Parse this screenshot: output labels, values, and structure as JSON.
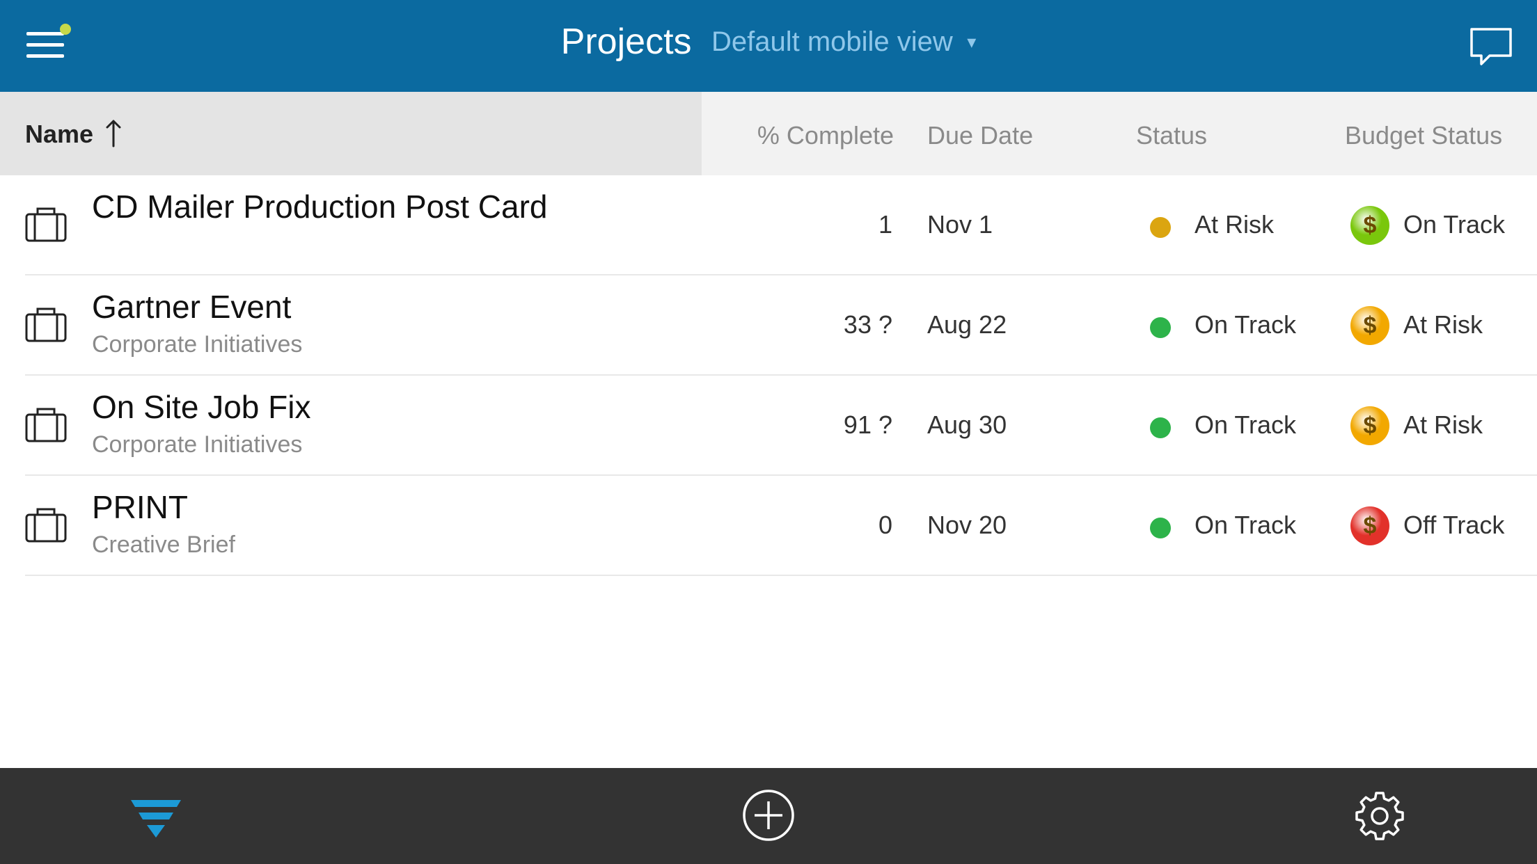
{
  "header": {
    "title": "Projects",
    "view_label": "Default mobile view",
    "view_caret": "▾"
  },
  "columns": {
    "name": "Name",
    "percent_complete": "% Complete",
    "due_date": "Due Date",
    "status": "Status",
    "budget_status": "Budget Status"
  },
  "rows": [
    {
      "name": "CD Mailer Production Post Card",
      "subtitle": "",
      "percent_complete": "1",
      "due_date": "Nov 1",
      "status": "At Risk",
      "status_color": "#dba510",
      "budget_status": "On Track",
      "budget_color": "#7ac70c",
      "budget_symbol": "$"
    },
    {
      "name": "Gartner Event",
      "subtitle": "Corporate Initiatives",
      "percent_complete": "33 ?",
      "due_date": "Aug 22",
      "status": "On Track",
      "status_color": "#2db34a",
      "budget_status": "At Risk",
      "budget_color": "#f2a800",
      "budget_symbol": "$"
    },
    {
      "name": "On Site Job Fix",
      "subtitle": "Corporate Initiatives",
      "percent_complete": "91 ?",
      "due_date": "Aug 30",
      "status": "On Track",
      "status_color": "#2db34a",
      "budget_status": "At Risk",
      "budget_color": "#f2a800",
      "budget_symbol": "$"
    },
    {
      "name": "PRINT",
      "subtitle": "Creative Brief",
      "percent_complete": "0",
      "due_date": "Nov 20",
      "status": "On Track",
      "status_color": "#2db34a",
      "budget_status": "Off Track",
      "budget_color": "#e2312a",
      "budget_symbol": "$"
    }
  ],
  "icons": {
    "menu": "menu-icon",
    "notification": "notification-dot-icon",
    "chat": "chat-bubble-icon",
    "sort": "sort-ascending-icon",
    "project": "briefcase-icon",
    "filter": "filter-icon",
    "add": "add-circle-icon",
    "settings": "gear-icon"
  },
  "colors": {
    "topbar": "#0b6aa0",
    "notification_dot": "#c6d94a",
    "bottombar": "#333333",
    "filter_accent": "#1c9ad6"
  }
}
